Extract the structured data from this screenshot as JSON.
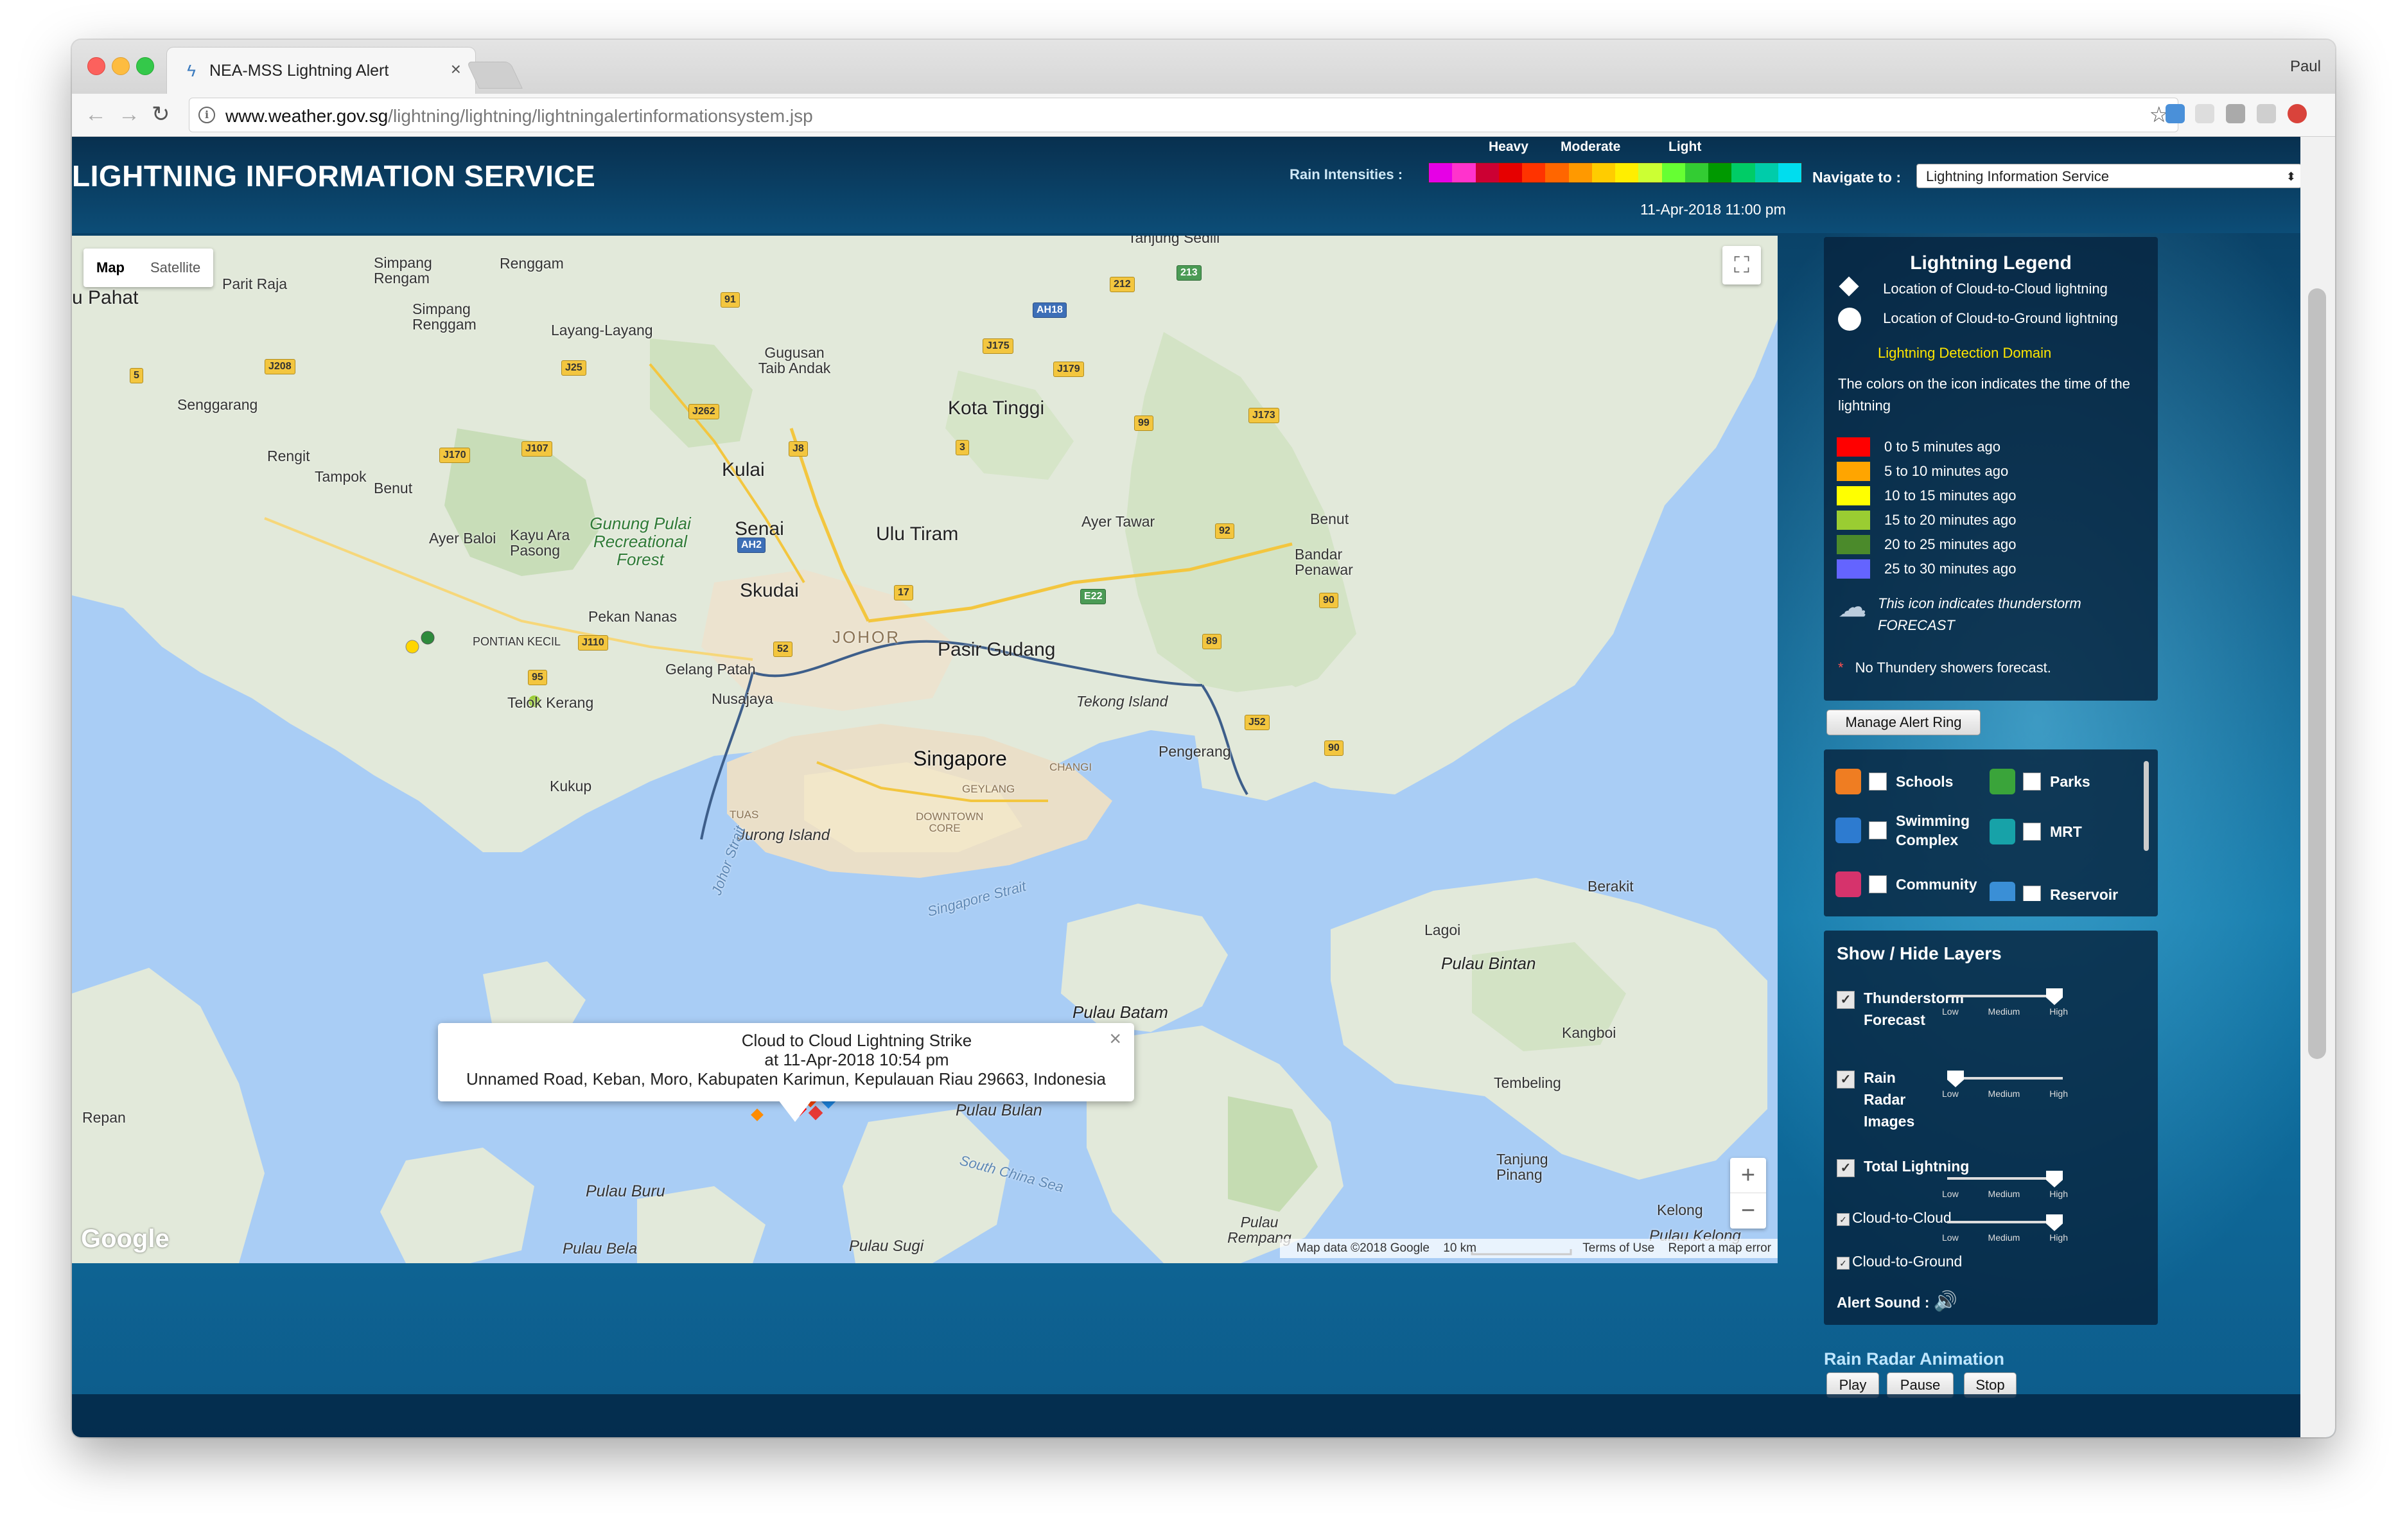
{
  "browser": {
    "tab_title": "NEA-MSS Lightning Alert",
    "profile_name": "Paul",
    "url_host": "www.weather.gov.sg",
    "url_path": "/lightning/lightning/lightningalertinformationsystem.jsp"
  },
  "header": {
    "title": "LIGHTNING INFORMATION SERVICE",
    "rain_label": "Rain Intensities :",
    "rain_scale": [
      "Heavy",
      "Moderate",
      "Light"
    ],
    "rain_colors": [
      "#e600e6",
      "#ff33cc",
      "#cc0033",
      "#e60000",
      "#ff3300",
      "#ff6600",
      "#ff9900",
      "#ffcc00",
      "#ffee00",
      "#ccff33",
      "#66ff33",
      "#33cc33",
      "#009900",
      "#00cc66",
      "#00ccaa",
      "#00ddee"
    ],
    "navigate_label": "Navigate to :",
    "navigate_value": "Lightning Information Service",
    "datetime": "11-Apr-2018   11:00 pm"
  },
  "map": {
    "type_controls": [
      "Map",
      "Satellite"
    ],
    "active_type": "Map",
    "google_logo": "Google",
    "footer": [
      "Map data ©2018 Google",
      "10 km",
      "Terms of Use",
      "Report a map error"
    ],
    "places": {
      "pahat": "u Pahat",
      "parit_raja": "Parit Raja",
      "simpang_rengam_1": "Simpang Rengam",
      "renggam": "Renggam",
      "simpang_renggam_2": "Simpang Renggam",
      "layang": "Layang-Layang",
      "gugusan": "Gugusan Taib Andak",
      "kota_tinggi": "Kota Tinggi",
      "senggarang": "Senggarang",
      "rengit": "Rengit",
      "tampok": "Tampok",
      "benut": "Benut",
      "kulai": "Kulai",
      "gunung_pulai": "Gunung Pulai Recreational Forest",
      "ayer_baloi": "Ayer Baloi",
      "kayu_ara": "Kayu Ara Pasong",
      "senai": "Senai",
      "ulu_tiram": "Ulu Tiram",
      "ayer_tawar": "Ayer Tawar",
      "benut_east": "Benut",
      "bandar_penawar": "Bandar Penawar",
      "skudai": "Skudai",
      "johor": "JOHOR",
      "pontian": "PONTIAN KECIL",
      "pekan_nanas": "Pekan Nanas",
      "pasir_gudang": "Pasir Gudang",
      "gelang_patah": "Gelang Patah",
      "nusajaya": "Nusajaya",
      "tekong": "Tekong Island",
      "telok_kerang": "Telok Kerang",
      "singapore": "Singapore",
      "changi": "CHANGI",
      "geylang": "GEYLANG",
      "downtown": "DOWNTOWN CORE",
      "pengerang": "Pengerang",
      "kukup": "Kukup",
      "tuas": "TUAS",
      "jurong": "Jurong Island",
      "johor_strait": "Johor Strait",
      "singapore_strait": "Singapore Strait",
      "berakit": "Berakit",
      "lagoi": "Lagoi",
      "pulau_bintan": "Pulau Bintan",
      "pulau_batam": "Pulau Batam",
      "kangboi": "Kangboi",
      "tembeling": "Tembeling",
      "pulau_bulan": "Pulau Bulan",
      "south_china_sea": "South China Sea",
      "tanjung_pinang": "Tanjung Pinang",
      "repan": "Repan",
      "pulau_buru": "Pulau Buru",
      "pulau_rempang": "Pulau Rempang",
      "kelong": "Kelong",
      "pulau_kelong": "Pulau Kelong",
      "pulau_bela": "Pulau Bela",
      "pulau_sugi": "Pulau Sugi",
      "tanjung_sedili": "Tanjung Sedili"
    },
    "shields": [
      "91",
      "212",
      "AH18",
      "213",
      "J175",
      "5",
      "J208",
      "J25",
      "J179",
      "J262",
      "99",
      "J173",
      "J8",
      "3",
      "J170",
      "J107",
      "AH2",
      "92",
      "17",
      "E22",
      "90",
      "J110",
      "52",
      "89",
      "95",
      "J52",
      "90"
    ],
    "infowindow": {
      "line1": "Cloud to Cloud Lightning Strike",
      "line2": "at 11-Apr-2018 10:54 pm",
      "line3": "Unnamed Road, Keban, Moro, Kabupaten Karimun, Kepulauan Riau 29663, Indonesia"
    }
  },
  "legend": {
    "title": "Lightning Legend",
    "cc": "Location of Cloud-to-Cloud lightning",
    "cg": "Location of Cloud-to-Ground lightning",
    "domain": "Lightning Detection Domain",
    "desc": "The colors on the icon indicates the time of the lightning",
    "ranges": [
      {
        "label": "0 to 5 minutes ago",
        "color": "#ff0000"
      },
      {
        "label": "5 to 10 minutes ago",
        "color": "#ffa500"
      },
      {
        "label": "10 to 15 minutes ago",
        "color": "#ffff00"
      },
      {
        "label": "15 to 20 minutes ago",
        "color": "#9acd32"
      },
      {
        "label": "20 to 25 minutes ago",
        "color": "#4b8a2b"
      },
      {
        "label": "25 to 30 minutes ago",
        "color": "#6464ff"
      }
    ],
    "forecast": "This icon indicates thunderstorm FORECAST",
    "no_thunder": "No Thundery showers forecast."
  },
  "buttons": {
    "manage_alert": "Manage Alert Ring",
    "play": "Play",
    "pause": "Pause",
    "stop": "Stop"
  },
  "poi": {
    "schools": "Schools",
    "parks": "Parks",
    "swimming": "Swimming Complex",
    "mrt": "MRT",
    "community": "Community",
    "reservoir": "Reservoir"
  },
  "layers": {
    "title": "Show / Hide Layers",
    "thunderstorm": "Thunderstorm Forecast",
    "rain_radar": "Rain Radar Images",
    "total": "Total Lightning",
    "cc": "Cloud-to-Cloud",
    "cg": "Cloud-to-Ground",
    "alert_sound": "Alert Sound :",
    "ticks": [
      "Low",
      "Medium",
      "High"
    ],
    "levels": {
      "thunderstorm": 1.0,
      "rain_radar": 0.0,
      "cc": 1.0,
      "cg": 1.0
    }
  },
  "rain_radar": {
    "title": "Rain Radar Animation"
  }
}
